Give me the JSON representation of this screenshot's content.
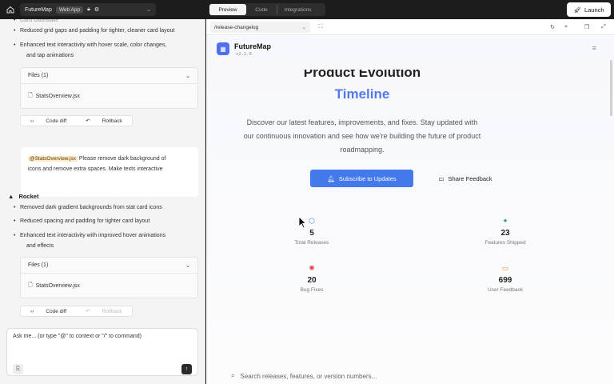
{
  "topbar": {
    "project_name": "FutureMap",
    "project_badge": "Web App",
    "tabs": [
      "Preview",
      "Code",
      "Integrations"
    ],
    "launch_label": "Launch"
  },
  "chat": {
    "prev_bullets": [
      "Reduced grid gaps and padding for tighter, cleaner card layout",
      "Enhanced text interactivity with hover scale, color changes,",
      "and tap animations"
    ],
    "files1": {
      "label": "Files (1)",
      "file": "StatsOverview.jsx"
    },
    "actions1": {
      "code_diff": "Code diff",
      "rollback": "Rollback"
    },
    "user_message": {
      "mention": "@StatsOverview.jsx",
      "line1": "Please remove dark background of",
      "line2": "icons and remove extra spaces. Make texts interactive"
    },
    "rocket_title": "Rocket",
    "rocket_bullets": [
      "Removed dark gradient backgrounds from stat card icons",
      "Reduced spacing and padding for tighter card layout",
      "Enhanced text interactivity with improved hover animations",
      "and effects"
    ],
    "files2": {
      "label": "Files (1)",
      "file": "StatsOverview.jsx"
    },
    "actions2": {
      "code_diff": "Code diff",
      "rollback": "Rollback"
    },
    "input_placeholder": "Ask me... (or type \"@\" to context or \"/\" to command)"
  },
  "preview": {
    "url": "/release-changelog",
    "site": {
      "brand": "FutureMap",
      "version": "v2.1.0",
      "heading_line1": "Product Evolution",
      "heading_line2": "Timeline",
      "subtitle": "Discover our latest features, improvements, and fixes. Stay updated with our continuous innovation and see how we're building the future of product roadmapping.",
      "subscribe_label": "Subscribe to Updates",
      "share_label": "Share Feedback",
      "stats": [
        {
          "value": "5",
          "label": "Total Releases",
          "icon": "cube-icon",
          "color": "#4f7cf0"
        },
        {
          "value": "23",
          "label": "Features Shipped",
          "icon": "sparkle-icon",
          "color": "#2ca86a"
        },
        {
          "value": "20",
          "label": "Bug Fixes",
          "icon": "bug-icon",
          "color": "#e04848"
        },
        {
          "value": "699",
          "label": "User Feedback",
          "icon": "message-icon",
          "color": "#f0902a"
        }
      ],
      "search_placeholder": "Search releases, features, or version numbers..."
    }
  }
}
